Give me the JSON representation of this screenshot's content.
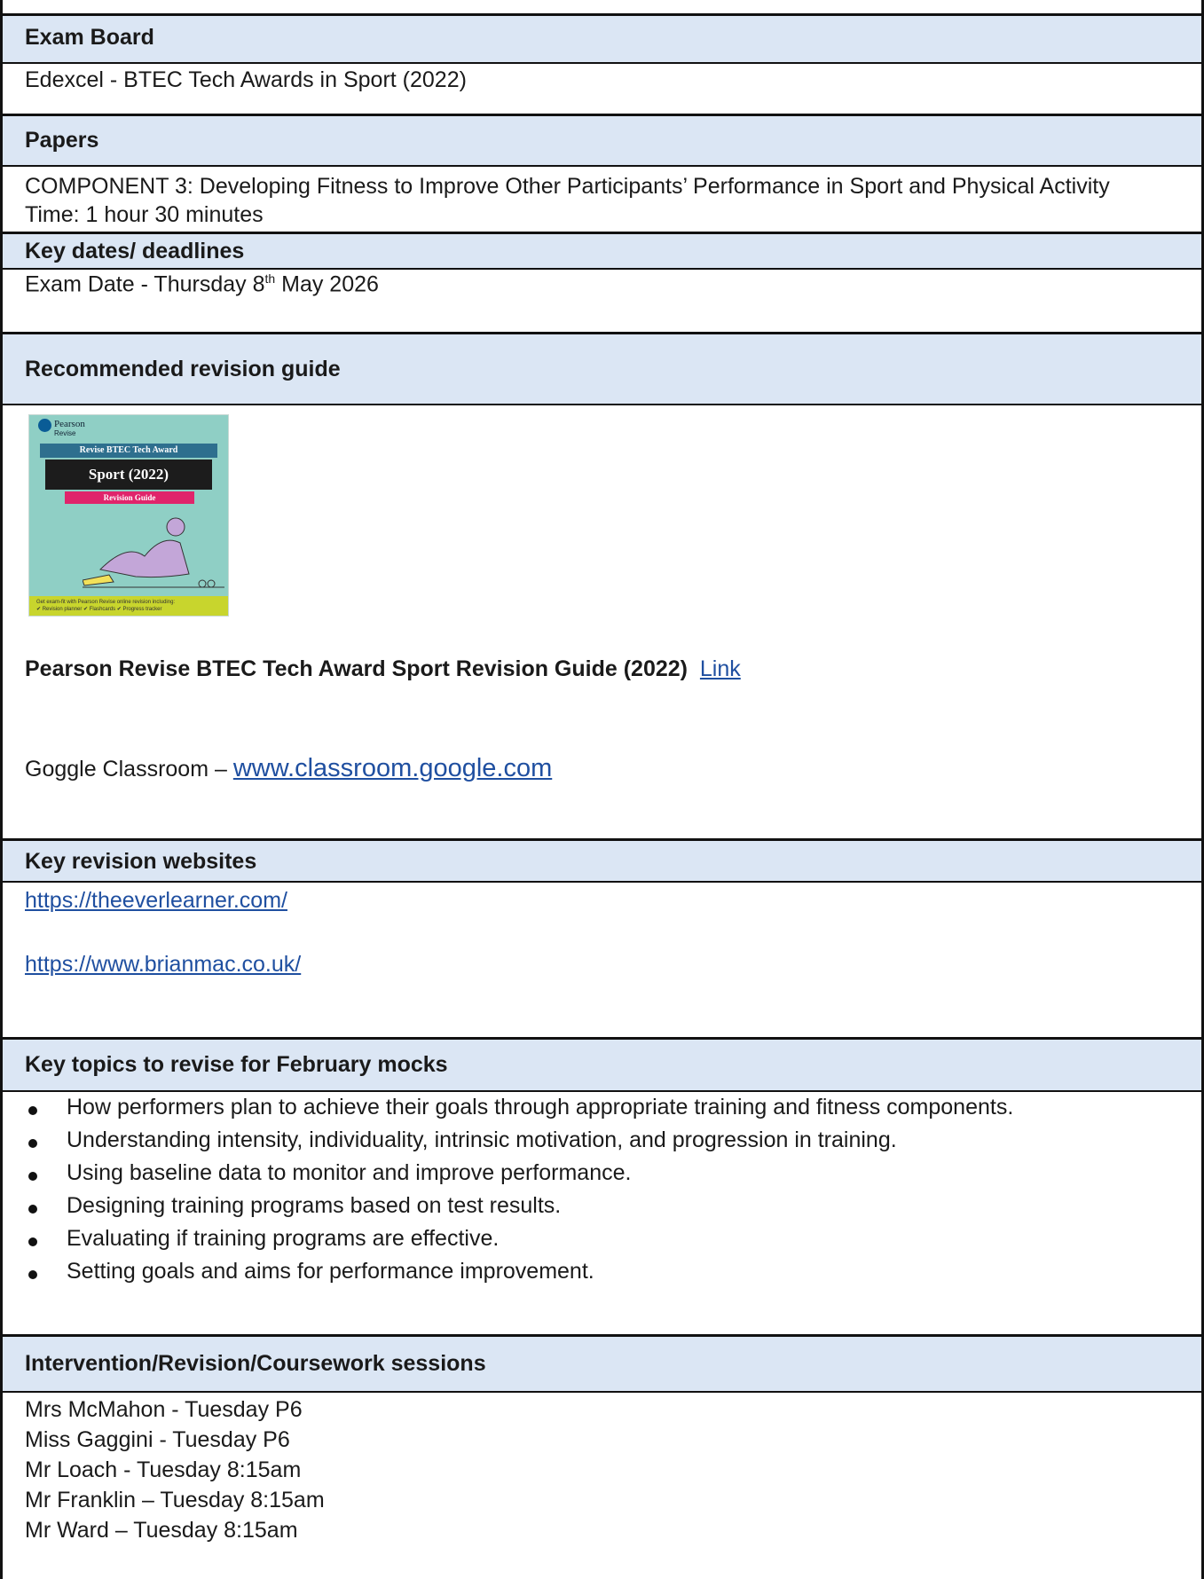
{
  "sections": {
    "exam_board": {
      "heading": "Exam Board",
      "value": "Edexcel - BTEC Tech Awards in Sport (2022)"
    },
    "papers": {
      "heading": "Papers",
      "component": "COMPONENT 3: Developing Fitness to Improve Other Participants’ Performance in Sport and Physical Activity",
      "time": "Time: 1 hour 30 minutes"
    },
    "key_dates": {
      "heading": "Key dates/ deadlines",
      "exam_prefix": "Exam Date  - Thursday 8",
      "exam_sup": "th",
      "exam_suffix": " May 2026"
    },
    "revision_guide": {
      "heading": "Recommended revision guide",
      "cover": {
        "publisher": "Pearson",
        "series": "Revise",
        "band_top": "Revise BTEC Tech Award",
        "band_title": "Sport (2022)",
        "band_sub": "Revision Guide",
        "footer_line1": "Get exam-fit with Pearson Revise online revision including:",
        "footer_line2": "✔ Revision planner   ✔ Flashcards   ✔ Progress tracker"
      },
      "guide_title": "Pearson Revise BTEC Tech Award Sport Revision Guide (2022)",
      "guide_link": "Link",
      "classroom_label": "Goggle Classroom – ",
      "classroom_link": "www.classroom.google.com"
    },
    "websites": {
      "heading": "Key revision websites",
      "links": [
        "https://theeverlearner.com/",
        "https://www.brianmac.co.uk/"
      ]
    },
    "topics": {
      "heading": "Key topics to revise for February mocks",
      "items": [
        "How performers plan to achieve their goals through appropriate training and fitness components.",
        "Understanding intensity, individuality, intrinsic motivation, and progression in training.",
        "Using baseline data to monitor and improve performance.",
        "Designing training programs based on test results.",
        "Evaluating if training programs are effective.",
        "Setting goals and aims for performance improvement."
      ]
    },
    "sessions": {
      "heading": "Intervention/Revision/Coursework sessions",
      "items": [
        "Mrs McMahon - Tuesday P6",
        "Miss Gaggini  - Tuesday P6",
        "Mr Loach - Tuesday 8:15am",
        "Mr Franklin – Tuesday 8:15am",
        "Mr Ward – Tuesday 8:15am"
      ]
    }
  },
  "colors": {
    "header_bg": "#dbe6f4",
    "border": "#111111",
    "link": "#1f4fa0"
  }
}
